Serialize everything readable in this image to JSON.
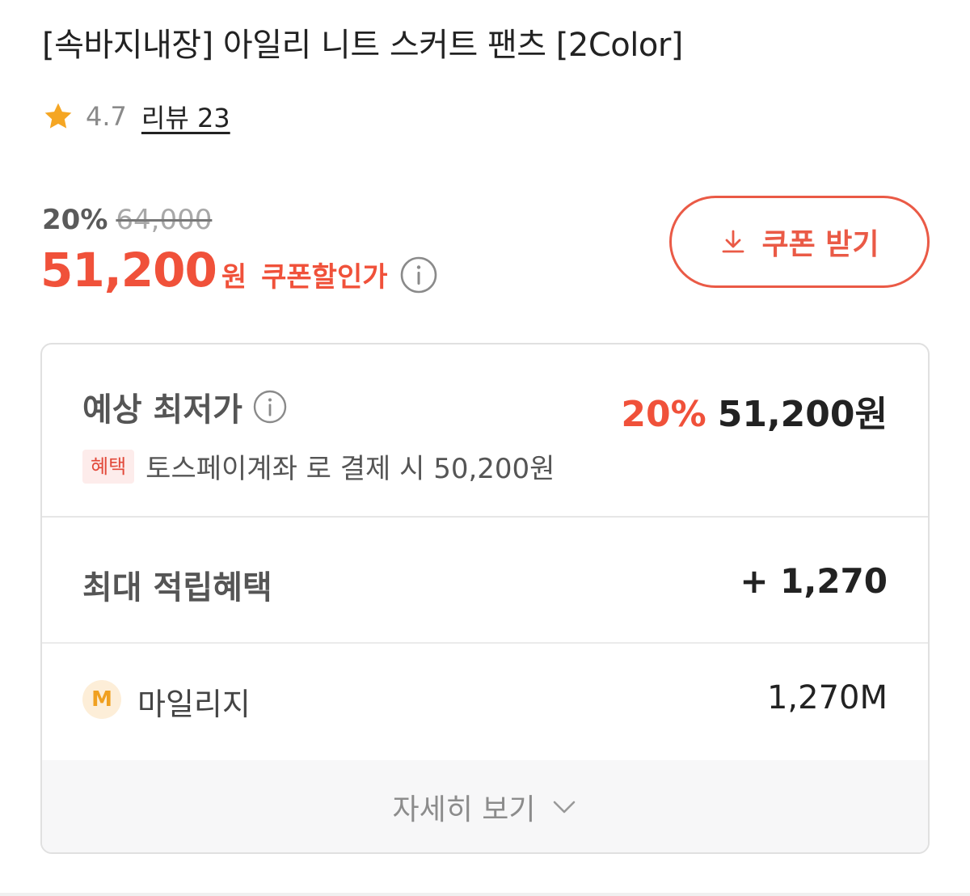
{
  "product": {
    "title": "[속바지내장] 아일리 니트 스커트 팬츠 [2Color]",
    "rating": "4.7",
    "review_link": "리뷰 23"
  },
  "price": {
    "discount_pct": "20%",
    "original_price": "64,000",
    "sale_price": "51,200",
    "currency": "원",
    "coupon_price_label": "쿠폰할인가"
  },
  "coupon_button": {
    "label": "쿠폰 받기"
  },
  "benefits": {
    "lowest": {
      "label": "예상 최저가",
      "pct": "20%",
      "value": "51,200원",
      "badge": "혜택",
      "text": "토스페이계좌 로 결제 시 50,200원"
    },
    "points": {
      "label": "최대 적립혜택",
      "value": "+ 1,270"
    },
    "mileage": {
      "badge": "M",
      "label": "마일리지",
      "value": "1,270M"
    },
    "detail_button": {
      "label": "자세히 보기"
    }
  },
  "icons": {
    "rating": "star-icon",
    "info": "info-icon",
    "download": "download-icon",
    "expand": "chevron-down-icon"
  },
  "colors": {
    "accent": "#f0513a",
    "star": "#f5a623",
    "badge_bg": "#fdeceb",
    "mileage_badge": "#fdeed8"
  }
}
